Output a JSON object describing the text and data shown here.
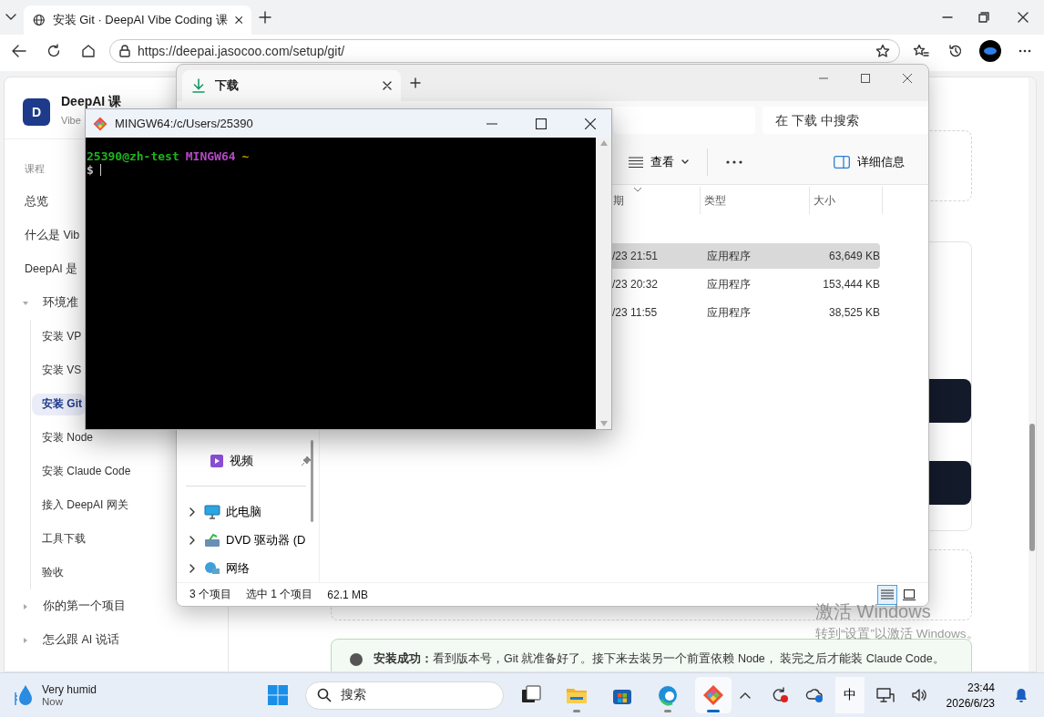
{
  "browser": {
    "tab_title": "安装 Git · DeepAI Vibe Coding 课",
    "address": "https://deepai.jasocoo.com/setup/git/",
    "site": {
      "logo": "D",
      "name": "DeepAI 课",
      "subtitle": "Vibe"
    },
    "sidebar": {
      "heading": "课程",
      "items": [
        {
          "kind": "link",
          "label": "总览",
          "selected": false
        },
        {
          "kind": "link",
          "label": "什么是 Vib",
          "selected": false
        },
        {
          "kind": "link",
          "label": "DeepAI 是",
          "selected": false
        },
        {
          "kind": "group",
          "label": "环境准",
          "expanded": true,
          "children": [
            {
              "kind": "link",
              "label": "安装 VP",
              "selected": false
            },
            {
              "kind": "link",
              "label": "安装 VS",
              "selected": false
            },
            {
              "kind": "link",
              "label": "安装 Git",
              "selected": true
            },
            {
              "kind": "link",
              "label": "安装 Node",
              "selected": false
            },
            {
              "kind": "link",
              "label": "安装 Claude Code",
              "selected": false
            },
            {
              "kind": "link",
              "label": "接入 DeepAI 网关",
              "selected": false
            },
            {
              "kind": "link",
              "label": "工具下载",
              "selected": false
            },
            {
              "kind": "link",
              "label": "验收",
              "selected": false
            }
          ]
        },
        {
          "kind": "group",
          "label": "你的第一个项目",
          "expanded": false
        },
        {
          "kind": "group",
          "label": "怎么跟 AI 说话",
          "expanded": false
        }
      ]
    },
    "note": "**安装成功：**看到版本号，Git 就准备好了。接下来去装另一个前置依赖 Node， 装完之后才能装 Claude Code。"
  },
  "explorer": {
    "tab": "下载",
    "search_placeholder": "在 下载 中搜索",
    "view_button": "查看",
    "details_button": "详细信息",
    "columns": [
      "期",
      "类型",
      "大小"
    ],
    "rows": [
      {
        "date": "/23 21:51",
        "type": "应用程序",
        "size": "63,649 KB",
        "selected": true
      },
      {
        "date": "/23 20:32",
        "type": "应用程序",
        "size": "153,444 KB",
        "selected": false
      },
      {
        "date": "/23 11:55",
        "type": "应用程序",
        "size": "38,525 KB",
        "selected": false
      }
    ],
    "nav": [
      {
        "kind": "pinned",
        "label": "视频"
      },
      {
        "kind": "divider"
      },
      {
        "kind": "computer",
        "label": "此电脑"
      },
      {
        "kind": "dvd",
        "label": "DVD 驱动器 (D"
      },
      {
        "kind": "network",
        "label": "网络"
      }
    ],
    "status": [
      "3 个项目",
      "选中 1 个项目",
      "62.1 MB"
    ],
    "views": [
      {
        "kind": "details",
        "selected": true
      },
      {
        "kind": "tiles",
        "selected": false
      }
    ]
  },
  "terminal": {
    "title": "MINGW64:/c/Users/25390",
    "lines": [
      [
        {
          "text": "25390@zh-test",
          "color": "#1cb41c"
        },
        {
          "text": "MINGW64",
          "color": "#b548c6"
        },
        {
          "text": "~",
          "color": "#c0a000"
        }
      ],
      [
        {
          "text": "$",
          "color": "#c0c0c0"
        }
      ]
    ]
  },
  "watermark": [
    "激活 Windows",
    "转到“设置”以激活 Windows。"
  ],
  "taskbar": {
    "weather": {
      "title": "Very humid",
      "subtitle": "Now"
    },
    "search_placeholder": "搜索",
    "apps": [
      {
        "kind": "taskview",
        "running": false,
        "active": false
      },
      {
        "kind": "folder",
        "running": true,
        "active": false
      },
      {
        "kind": "store",
        "running": false,
        "active": false
      },
      {
        "kind": "edge",
        "running": true,
        "active": false
      },
      {
        "kind": "git",
        "running": true,
        "active": true
      }
    ],
    "ime": "中",
    "time": "23:44",
    "date": "2026/6/23"
  }
}
